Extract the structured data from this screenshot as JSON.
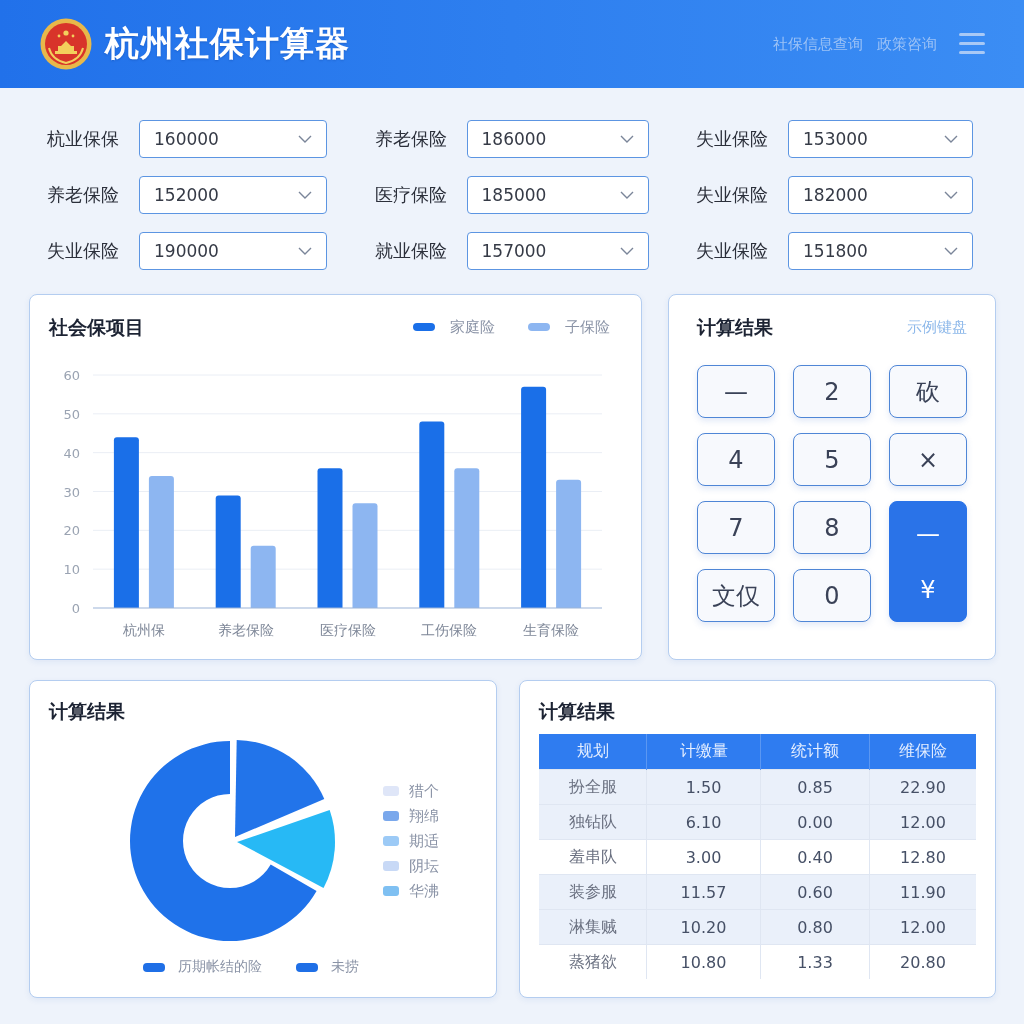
{
  "header": {
    "title": "杭州社保计算器",
    "links": [
      "社保信息查询",
      "政策咨询"
    ]
  },
  "form": {
    "fields": [
      {
        "label": "杭业保保",
        "value": "160000"
      },
      {
        "label": "养老保险",
        "value": "186000"
      },
      {
        "label": "失业保险",
        "value": "153000"
      },
      {
        "label": "养老保险",
        "value": "152000"
      },
      {
        "label": "医疗保险",
        "value": "185000"
      },
      {
        "label": "失业保险",
        "value": "182000"
      },
      {
        "label": "失业保险",
        "value": "190000"
      },
      {
        "label": "就业保险",
        "value": "157000"
      },
      {
        "label": "失业保险",
        "value": "151800"
      }
    ]
  },
  "bar_card": {
    "title": "社会保项目",
    "chart_data": {
      "type": "bar",
      "categories": [
        "杭州保",
        "养老保险",
        "医疗保险",
        "工伤保险",
        "生育保险"
      ],
      "series": [
        {
          "name": "家庭险",
          "color": "#1a6fe8",
          "values": [
            44,
            29,
            36,
            48,
            57
          ]
        },
        {
          "name": "子保险",
          "color": "#8db6f1",
          "values": [
            34,
            16,
            27,
            36,
            33
          ]
        }
      ],
      "ylim": [
        0,
        60
      ],
      "yticks": [
        0,
        10,
        20,
        30,
        40,
        50,
        60
      ],
      "grid": true
    }
  },
  "keypad_card": {
    "title": "计算结果",
    "link": "示例键盘",
    "keys": [
      {
        "kind": "key",
        "label": "—"
      },
      {
        "kind": "key",
        "label": "2"
      },
      {
        "kind": "key",
        "label": "砍"
      },
      {
        "kind": "key",
        "label": "4"
      },
      {
        "kind": "key",
        "label": "5"
      },
      {
        "kind": "key",
        "label": "×"
      },
      {
        "kind": "key",
        "label": "7"
      },
      {
        "kind": "key",
        "label": "8"
      },
      {
        "kind": "primary",
        "label": "—",
        "sublabel": "¥"
      },
      {
        "kind": "key",
        "label": "文仅"
      },
      {
        "kind": "key",
        "label": "0"
      }
    ]
  },
  "pie_card": {
    "title": "计算结果",
    "legend": [
      {
        "label": "猎个",
        "color": "#dfe6f8"
      },
      {
        "label": "翔绵",
        "color": "#7aa8ec"
      },
      {
        "label": "期适",
        "color": "#9ccaf6"
      },
      {
        "label": "阴坛",
        "color": "#c8d9f6"
      },
      {
        "label": "华沸",
        "color": "#7fc0f2"
      }
    ],
    "legend_bottom": [
      {
        "label": "历期帐结的险",
        "color": "#1f6fe6"
      },
      {
        "label": "未捞",
        "color": "#1f6fe6"
      }
    ]
  },
  "table_card": {
    "title": "计算结果",
    "columns": [
      "规划",
      "计缴量",
      "统计额",
      "维保险"
    ],
    "rows": [
      [
        "扮全服",
        "1.50",
        "0.85",
        "22.90"
      ],
      [
        "独钻队",
        "6.10",
        "0.00",
        "12.00"
      ],
      [
        "羞串队",
        "3.00",
        "0.40",
        "12.80"
      ],
      [
        "装参服",
        "11.57",
        "0.60",
        "11.90"
      ],
      [
        "淋集贼",
        "10.20",
        "0.80",
        "12.00"
      ],
      [
        "蒸猪欲",
        "10.80",
        "1.33",
        "20.80"
      ]
    ]
  }
}
